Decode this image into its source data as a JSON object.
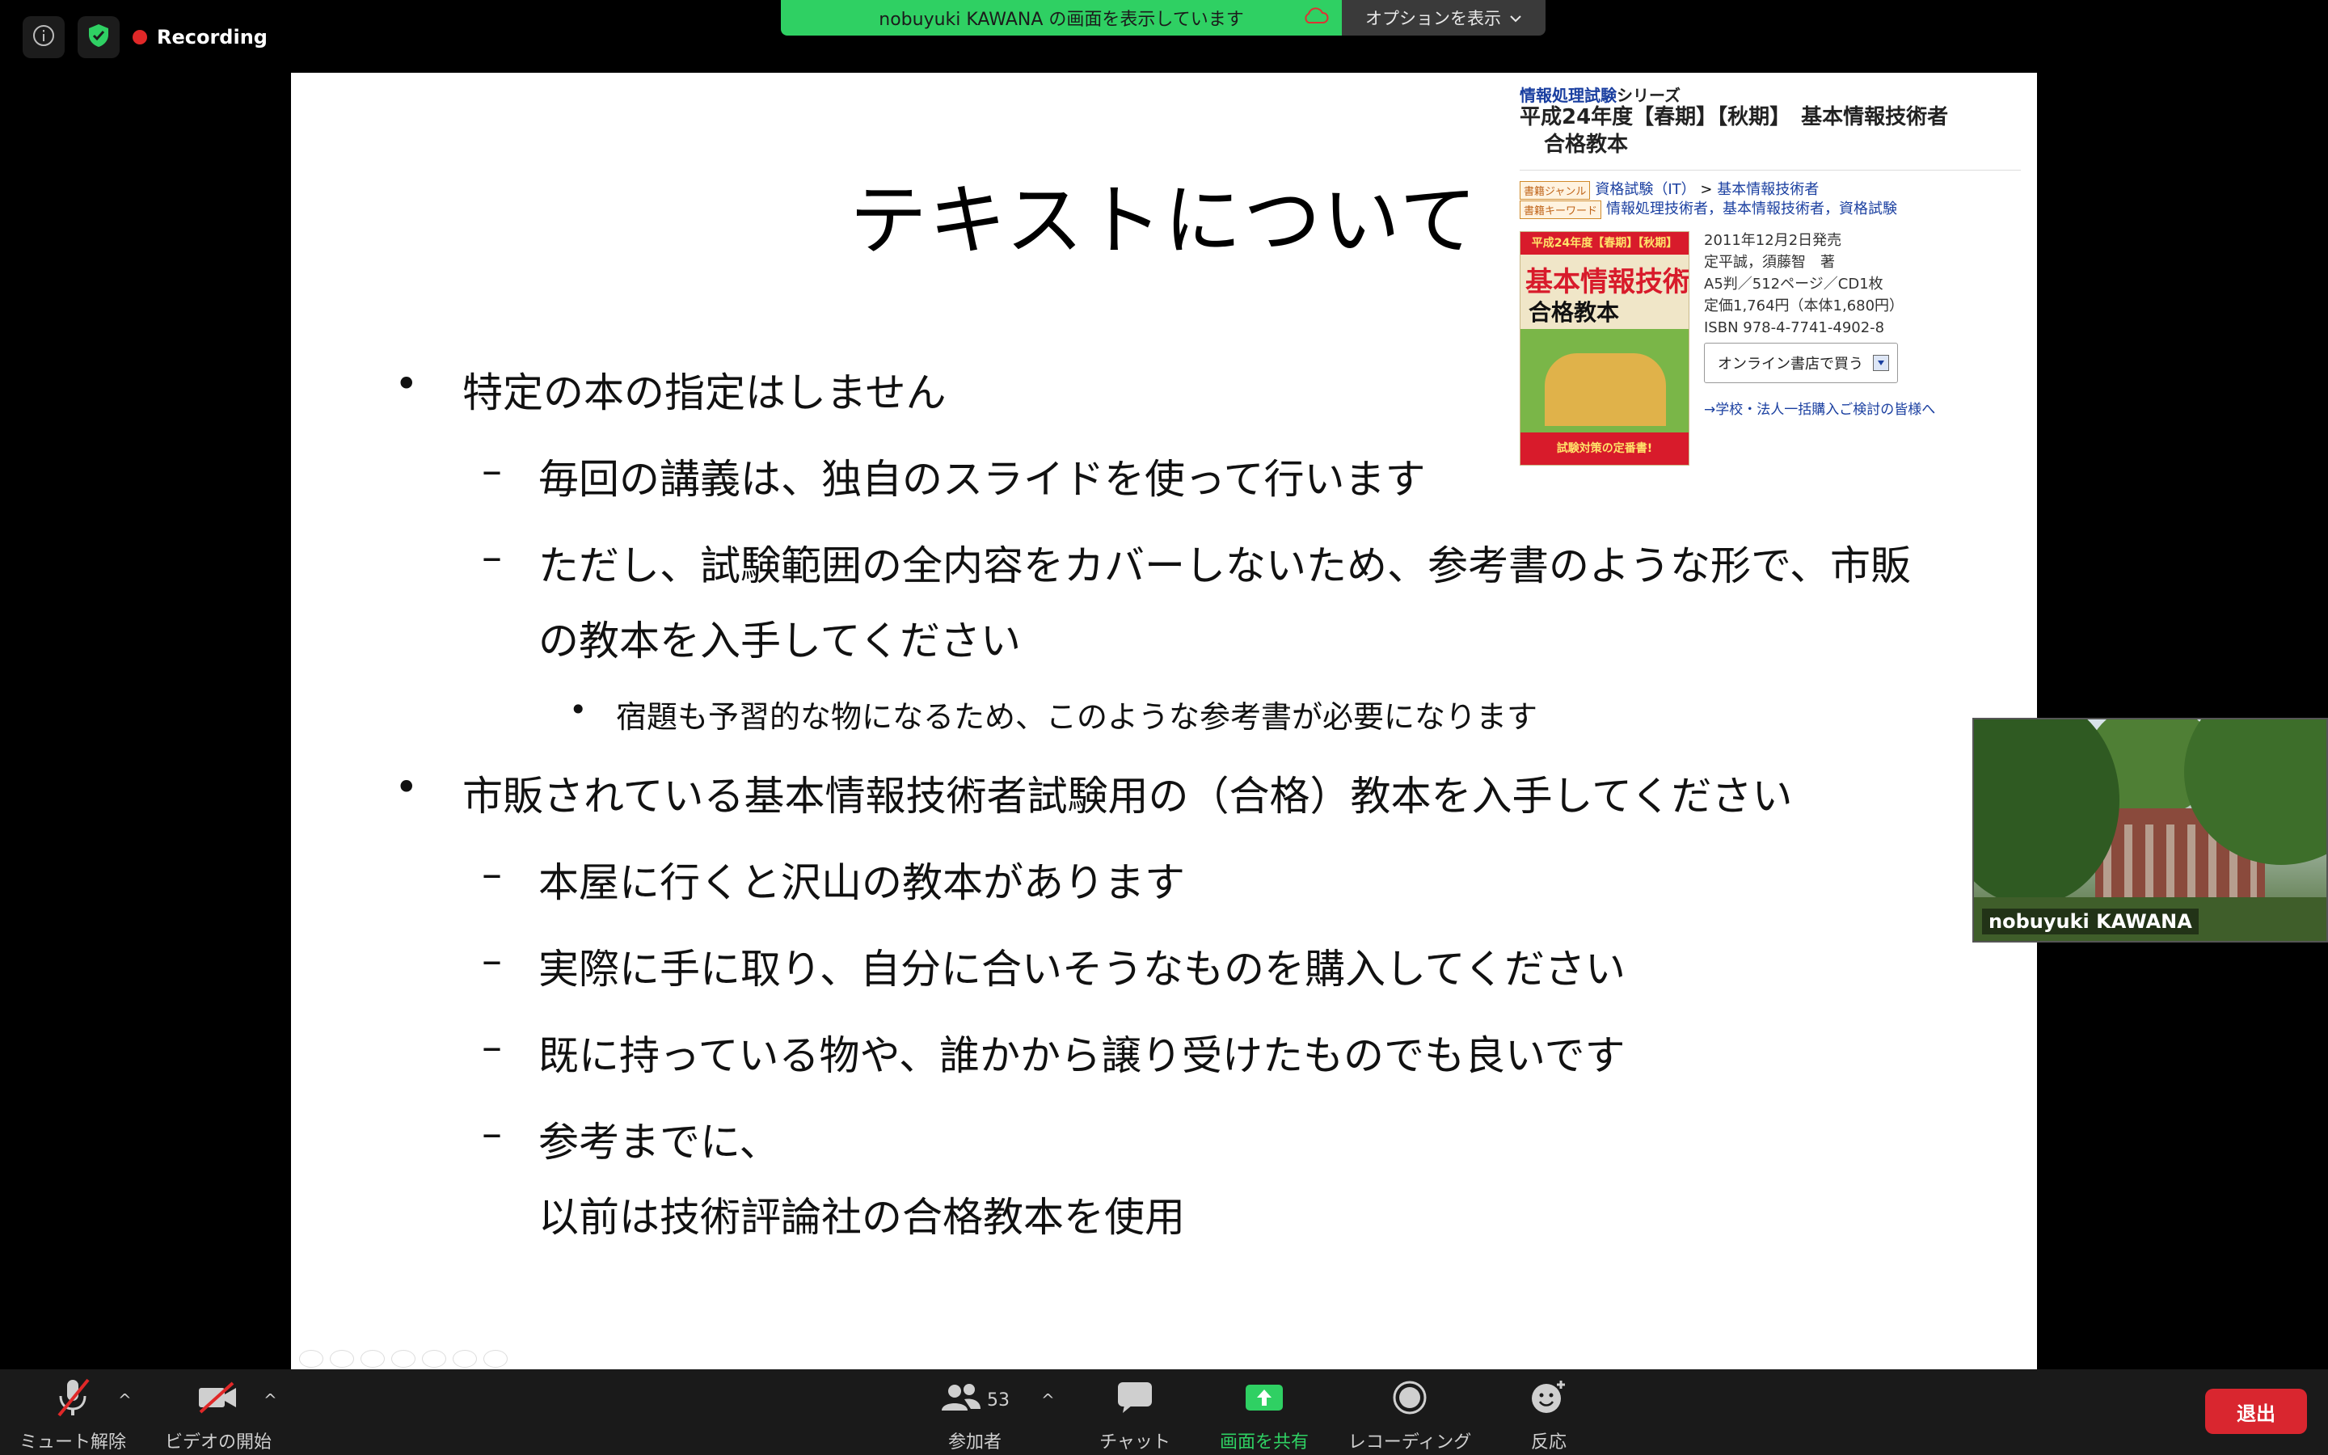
{
  "top": {
    "recording": "Recording",
    "share_banner": "nobuyuki KAWANA の画面を表示しています",
    "options": "オプションを表示"
  },
  "slide": {
    "title": "テキストについて",
    "lines": [
      {
        "level": 1,
        "text": "特定の本の指定はしません"
      },
      {
        "level": 2,
        "text": "毎回の講義は、独自のスライドを使って行います"
      },
      {
        "level": 2,
        "text": "ただし、試験範囲の全内容をカバーしないため、参考書のような形で、市販"
      },
      {
        "level": 0,
        "text": "の教本を入手してください"
      },
      {
        "level": 3,
        "text": "宿題も予習的な物になるため、このような参考書が必要になります"
      },
      {
        "level": 1,
        "text": "市販されている基本情報技術者試験用の（合格）教本を入手してください"
      },
      {
        "level": 2,
        "text": "本屋に行くと沢山の教本があります"
      },
      {
        "level": 2,
        "text": "実際に手に取り、自分に合いそうなものを購入してください"
      },
      {
        "level": 2,
        "text": "既に持っている物や、誰かから譲り受けたものでも良いです"
      },
      {
        "level": 2,
        "text": "参考までに、"
      },
      {
        "level": 0,
        "text": "以前は技術評論社の合格教本を使用"
      }
    ],
    "book": {
      "series_link": "情報処理試験",
      "series_suffix": "シリーズ",
      "title_line1": "平成24年度【春期】【秋期】　基本情報技術者",
      "title_line2": "合格教本",
      "genre_tag": "書籍ジャンル",
      "genre_link1": "資格試験（IT）",
      "genre_arrow": ">",
      "genre_link2": "基本情報技術者",
      "keyword_tag": "書籍キーワード",
      "keywords": "情報処理技術者，基本情報技術者，資格試験",
      "cover_top": "平成24年度【春期】【秋期】",
      "cover_main": "基本情報技術者",
      "cover_sub": "合格教本",
      "cover_bottom": "試験対策の定番書!",
      "release": "2011年12月2日発売",
      "authors": "定平誠，須藤智　著",
      "format": "A5判／512ページ／CD1枚",
      "price": "定価1,764円（本体1,680円）",
      "isbn": "ISBN 978-4-7741-4902-8",
      "buy_button": "オンライン書店で買う",
      "bulk_link": "→学校・法人一括購入ご検討の皆様へ"
    }
  },
  "video": {
    "name": "nobuyuki KAWANA"
  },
  "toolbar": {
    "mute": "ミュート解除",
    "video": "ビデオの開始",
    "participants": "参加者",
    "participant_count": "53",
    "chat": "チャット",
    "share": "画面を共有",
    "record": "レコーディング",
    "reactions": "反応",
    "leave": "退出"
  },
  "colors": {
    "share_green": "#2fd063",
    "leave_red": "#d9262f",
    "record_red": "#e02828"
  }
}
